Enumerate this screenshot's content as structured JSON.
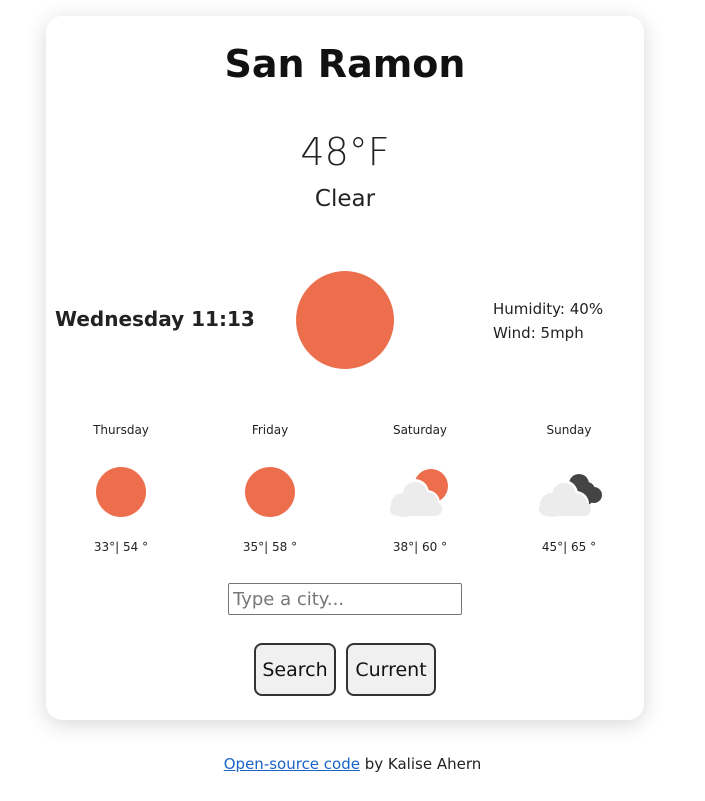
{
  "current": {
    "city": "San Ramon",
    "temperature": "48°F",
    "description": "Clear",
    "day_time": "Wednesday 11:13",
    "icon": "sun-icon",
    "humidity": "Humidity: 40%",
    "wind": "Wind: 5mph"
  },
  "forecast": [
    {
      "day": "Thursday",
      "icon": "sun-icon",
      "temps": "33°| 54 °"
    },
    {
      "day": "Friday",
      "icon": "sun-icon",
      "temps": "35°| 58 °"
    },
    {
      "day": "Saturday",
      "icon": "partly-cloudy-icon",
      "temps": "38°| 60 °"
    },
    {
      "day": "Sunday",
      "icon": "cloudy-icon",
      "temps": "45°| 65 °"
    }
  ],
  "search": {
    "placeholder": "Type a city...",
    "value": "",
    "search_label": "Search",
    "current_label": "Current"
  },
  "footer": {
    "link_text": "Open-source code",
    "suffix": " by Kalise Ahern"
  },
  "colors": {
    "sun": "#ec6e4c",
    "cloud_light": "#ececec",
    "cloud_dark": "#444444",
    "link": "#1a63c7"
  }
}
